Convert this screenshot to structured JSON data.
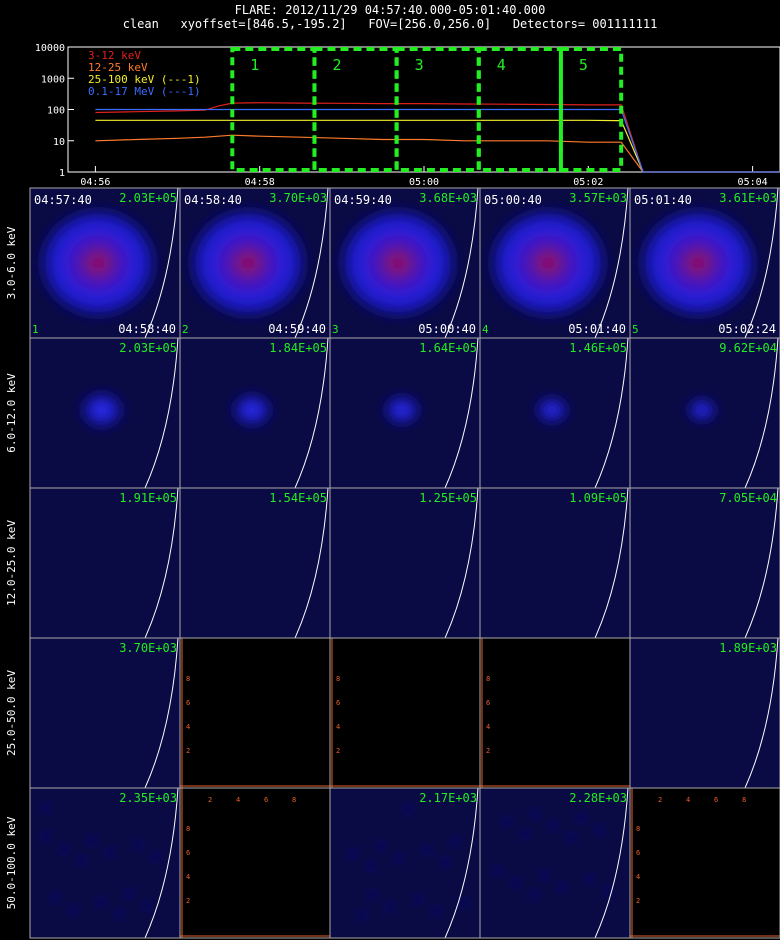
{
  "header": {
    "line1": "FLARE: 2012/11/29 04:57:40.000-05:01:40.000",
    "line2": "clean   xyoffset=[846.5,-195.2]   FOV=[256.0,256.0]   Detectors= 001111111"
  },
  "colors": {
    "band_3_12": "#e0201c",
    "band_12_25": "#ff7b2a",
    "band_25_100": "#f2ee2e",
    "band_100_17000": "#3a6cff",
    "label_green": "#22ee22",
    "interval_box": "#22ee22",
    "limb": "#ffffff",
    "empty_axis": "#e8602a"
  },
  "chart_data": [
    {
      "type": "line",
      "name": "lightcurve",
      "yscale": "log",
      "ylim": [
        1,
        10000
      ],
      "xlim": [
        "04:55:40",
        "05:04:20"
      ],
      "yticks": [
        "1",
        "10",
        "100",
        "1000",
        "10000"
      ],
      "xticks": [
        "04:56",
        "04:58",
        "05:00",
        "05:02",
        "05:04"
      ],
      "legend": [
        "3-12 keV",
        "12-25 keV",
        "25-100 keV (---1)",
        "0.1-17 MeV (---1)"
      ],
      "legend_position": "top-left",
      "intervals": [
        {
          "label": "1",
          "start": "04:57:40",
          "end": "04:58:40"
        },
        {
          "label": "2",
          "start": "04:58:40",
          "end": "04:59:40"
        },
        {
          "label": "3",
          "start": "04:59:40",
          "end": "05:00:40"
        },
        {
          "label": "4",
          "start": "05:00:40",
          "end": "05:01:40"
        },
        {
          "label": "5",
          "start": "05:01:40",
          "end": "05:02:24"
        }
      ],
      "x": [
        "04:56:00",
        "04:56:30",
        "04:57:00",
        "04:57:20",
        "04:57:30",
        "04:57:40",
        "04:58:00",
        "04:58:30",
        "04:59:00",
        "04:59:30",
        "05:00:00",
        "05:00:30",
        "05:01:00",
        "05:01:30",
        "05:02:00",
        "05:02:20",
        "05:02:24",
        "05:02:40",
        "05:03:00",
        "05:04:00",
        "05:04:20"
      ],
      "series": [
        {
          "name": "3-12 keV",
          "values": [
            80,
            85,
            90,
            95,
            130,
            160,
            165,
            160,
            158,
            155,
            155,
            150,
            148,
            145,
            140,
            140,
            140,
            1,
            1,
            1,
            1
          ]
        },
        {
          "name": "12-25 keV",
          "values": [
            10,
            11,
            12,
            13,
            14,
            15,
            14,
            13,
            12,
            11,
            11,
            10,
            10,
            10,
            9,
            9,
            9,
            1,
            1,
            1,
            1
          ]
        },
        {
          "name": "25-100 keV (---1)",
          "values": [
            45,
            45,
            45,
            45,
            45,
            45,
            45,
            45,
            45,
            45,
            45,
            45,
            45,
            45,
            45,
            44,
            44,
            1,
            1,
            1,
            1
          ]
        },
        {
          "name": "0.1-17 MeV (---1)",
          "values": [
            100,
            100,
            100,
            100,
            100,
            100,
            100,
            100,
            100,
            100,
            100,
            100,
            100,
            100,
            100,
            100,
            100,
            1,
            1,
            1,
            1
          ]
        }
      ]
    },
    {
      "type": "heatmap",
      "name": "image-cube",
      "energy_bands": [
        "3.0-6.0 keV",
        "6.0-12.0 keV",
        "12.0-25.0 keV",
        "25.0-50.0 keV",
        "50.0-100.0 keV"
      ],
      "intervals": [
        "1",
        "2",
        "3",
        "4",
        "5"
      ],
      "start_times": [
        "04:57:40",
        "04:58:40",
        "04:59:40",
        "05:00:40",
        "05:01:40"
      ],
      "end_times": [
        "04:58:40",
        "04:59:40",
        "05:00:40",
        "05:01:40",
        "05:02:24"
      ],
      "peaks": [
        [
          "2.03E+05",
          "3.70E+03",
          "3.68E+03",
          "3.57E+03",
          "3.61E+03"
        ],
        [
          "2.03E+05",
          "1.84E+05",
          "1.64E+05",
          "1.46E+05",
          "9.62E+04"
        ],
        [
          "1.91E+05",
          "1.54E+05",
          "1.25E+05",
          "1.09E+05",
          "7.05E+04"
        ],
        [
          "3.70E+03",
          null,
          null,
          null,
          "1.89E+03"
        ],
        [
          "2.35E+03",
          null,
          "2.17E+03",
          "2.28E+03",
          null
        ]
      ],
      "empty_axis_ticks": [
        "2",
        "4",
        "6",
        "8"
      ]
    }
  ]
}
